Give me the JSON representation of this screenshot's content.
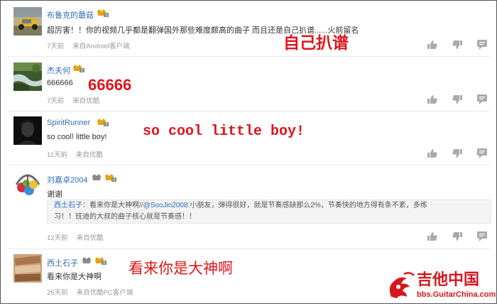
{
  "comments": [
    {
      "username": "布鲁克的蘑菇",
      "text": "超厉害！！你的视频几乎都是翻弹国外那些难度颇高的曲子 而且还是自己扒谱......火前留名",
      "time": "7天前",
      "source": "来自Android客户端",
      "overlay": "自己扒谱"
    },
    {
      "username": "杰夫何",
      "text": "666666",
      "time": "7天前",
      "source": "来自优酷",
      "overlay": "66666"
    },
    {
      "username": "SpiritRunner",
      "text": "so cool! little boy!",
      "time": "11天前",
      "source": "来自优酷",
      "overlay": "so cool little boy!"
    },
    {
      "username": "刘嘉卓2004",
      "text": "谢谢",
      "time": "12天前",
      "source": "来自优酷",
      "quote": {
        "name": "西土石子",
        "before": "：看来你是大神啊//",
        "link": "@SooJin2008",
        "after": ":小朋友，弹得很好，就是节奏感缺那么2%，节奏快的地方得有条不紊，多练",
        "line2": "习！！班迪的大叔的曲子核心就是节奏感！！"
      }
    },
    {
      "username": "西土石子",
      "text": "看来你是大神啊",
      "time": "26天前",
      "source": "来自优酷PC客户端",
      "overlay": "看来你是大神啊"
    }
  ],
  "watermark": {
    "title": "吉他中国",
    "url": "bbs.GuitarChina.com"
  },
  "colors": {
    "username": "#2f6eb5",
    "overlay": "#e1141a",
    "meta": "#9a9a9a"
  }
}
